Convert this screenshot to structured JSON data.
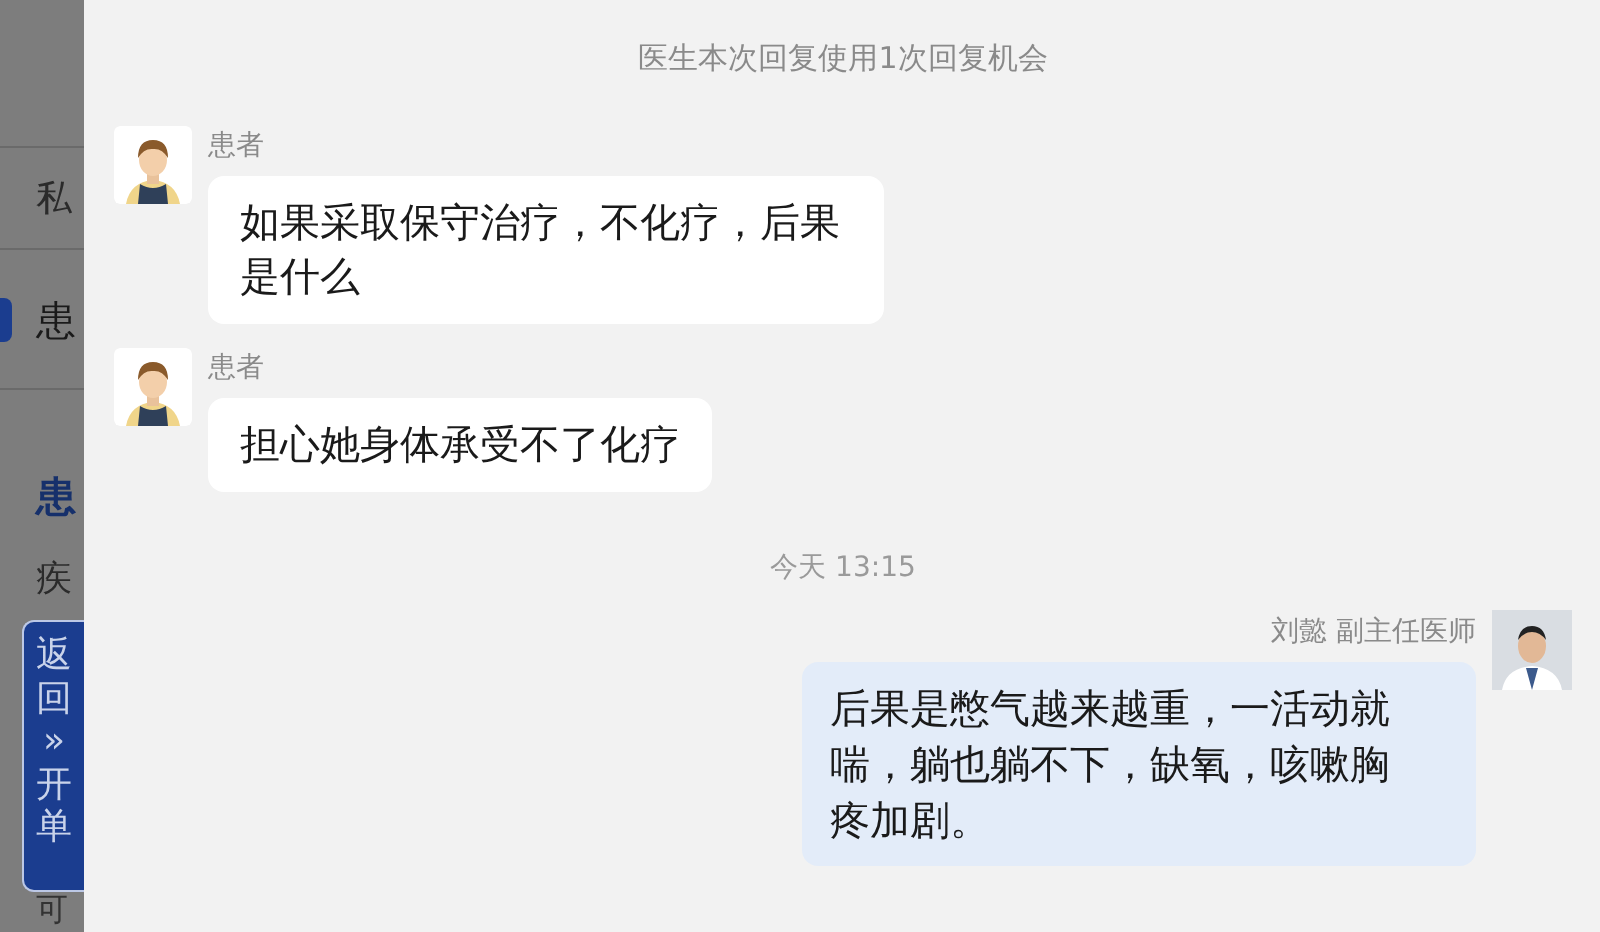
{
  "background_page": {
    "items": [
      {
        "text": "私",
        "kind": "label"
      },
      {
        "text": "患",
        "kind": "active"
      },
      {
        "text": "患",
        "kind": "heading"
      },
      {
        "text": "疾",
        "kind": "label"
      },
      {
        "text": "可",
        "kind": "footer"
      }
    ],
    "float_button": {
      "label": "返回»开单"
    }
  },
  "chat": {
    "notice": "医生本次回复使用1次回复机会",
    "messages": [
      {
        "kind": "patient",
        "sender": "患者",
        "text": "如果采取保守治疗，不化疗，后果是什么"
      },
      {
        "kind": "patient",
        "sender": "患者",
        "text": "担心她身体承受不了化疗"
      },
      {
        "kind": "time",
        "text": "今天 13:15"
      },
      {
        "kind": "doctor",
        "sender": "刘懿 副主任医师",
        "text": "后果是憋气越来越重，一活动就喘，躺也躺不下，缺氧，咳嗽胸疼加剧。"
      }
    ]
  }
}
